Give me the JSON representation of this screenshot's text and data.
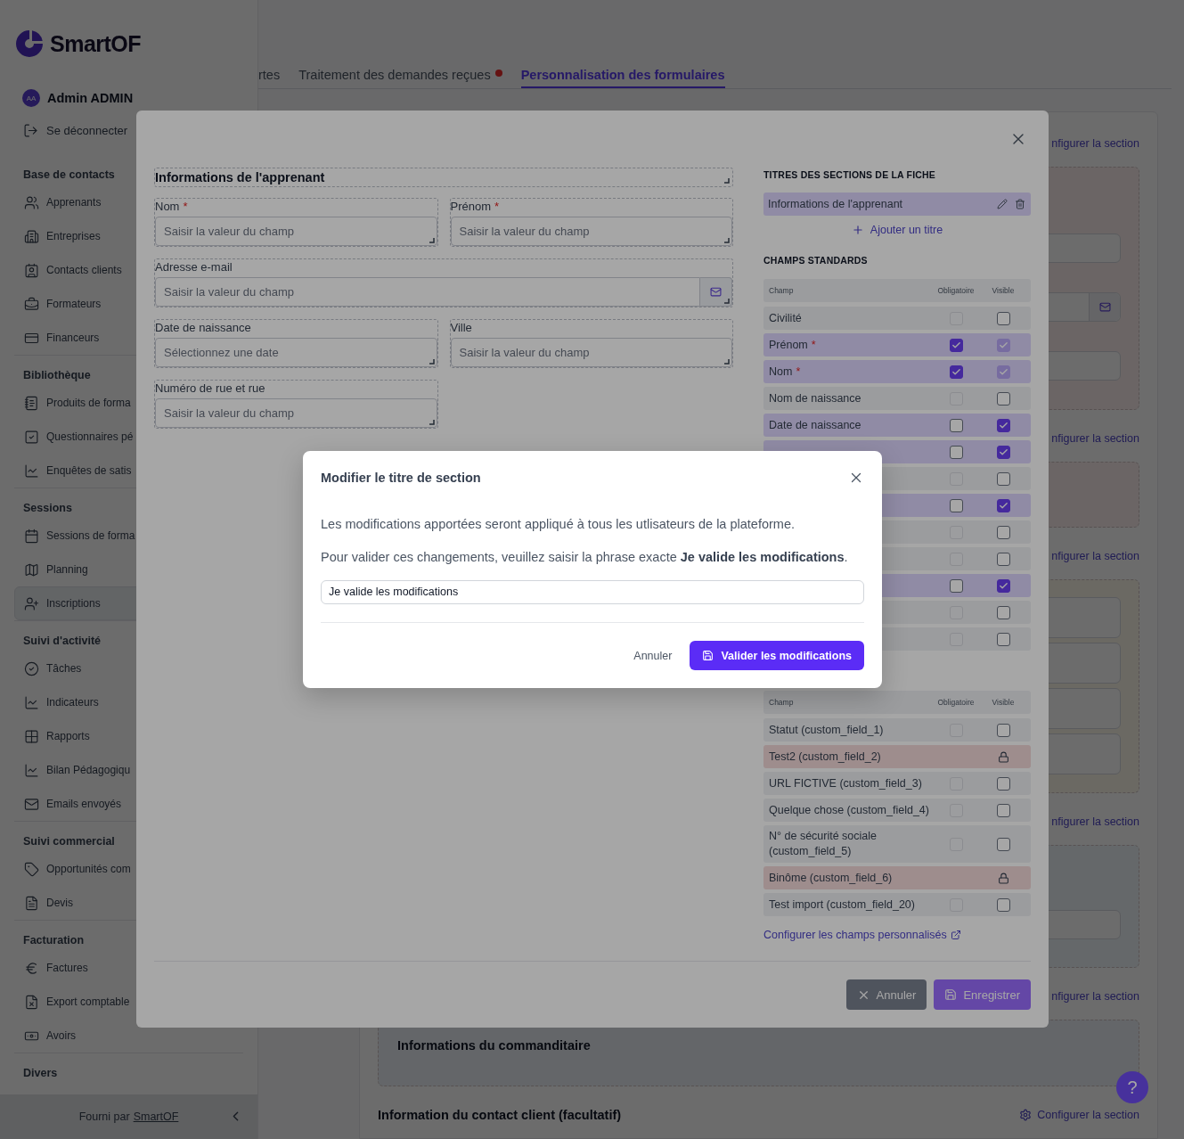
{
  "sidebar": {
    "logo": "SmartOF",
    "user": {
      "initials": "AA",
      "name": "Admin ADMIN"
    },
    "logout": "Se déconnecter",
    "sections": [
      {
        "title": "Base de contacts",
        "items": [
          {
            "label": "Apprenants",
            "selected": false
          },
          {
            "label": "Entreprises",
            "selected": false
          },
          {
            "label": "Contacts clients",
            "selected": false
          },
          {
            "label": "Formateurs",
            "selected": false
          },
          {
            "label": "Financeurs",
            "selected": false
          }
        ]
      },
      {
        "title": "Bibliothèque",
        "items": [
          {
            "label": "Produits de forma",
            "selected": false
          },
          {
            "label": "Questionnaires pé",
            "selected": false
          },
          {
            "label": "Enquêtes de satis",
            "selected": false
          }
        ]
      },
      {
        "title": "Sessions",
        "items": [
          {
            "label": "Sessions de forma",
            "selected": false
          },
          {
            "label": "Planning",
            "selected": false
          },
          {
            "label": "Inscriptions",
            "selected": true
          }
        ]
      },
      {
        "title": "Suivi d'activité",
        "items": [
          {
            "label": "Tâches",
            "selected": false
          },
          {
            "label": "Indicateurs",
            "selected": false
          },
          {
            "label": "Rapports",
            "selected": false
          },
          {
            "label": "Bilan Pédagogiqu",
            "selected": false
          },
          {
            "label": "Emails envoyés",
            "selected": false
          }
        ]
      },
      {
        "title": "Suivi commercial",
        "items": [
          {
            "label": "Opportunités com",
            "selected": false
          },
          {
            "label": "Devis",
            "selected": false
          }
        ]
      },
      {
        "title": "Facturation",
        "items": [
          {
            "label": "Factures",
            "selected": false
          },
          {
            "label": "Export comptable",
            "selected": false
          },
          {
            "label": "Avoirs",
            "selected": false
          }
        ]
      },
      {
        "title": "Divers"
      }
    ],
    "footer": {
      "text": "Fourni par",
      "link": "SmartOF"
    }
  },
  "tabs": [
    {
      "label": "rtes",
      "selected": false,
      "badge": false
    },
    {
      "label": "Traitement des demandes reçues",
      "selected": false,
      "badge": true
    },
    {
      "label": "Personnalisation des formulaires",
      "selected": true,
      "badge": false
    }
  ],
  "page": {
    "sections": [
      {
        "link": "nfigurer la section",
        "gear": false,
        "card": {
          "kind": "pink",
          "inputs": [
            {
              "kind": "text"
            },
            {
              "kind": "email"
            },
            {
              "kind": "text"
            }
          ]
        }
      },
      {
        "link": "nfigurer la section",
        "gear": false,
        "card": {
          "kind": "pink"
        }
      },
      {
        "link": "nfigurer la section",
        "gear": false,
        "card": {
          "kind": "amber",
          "inputs": [
            {
              "kind": "tall"
            },
            {
              "kind": "tall"
            },
            {
              "kind": "tall"
            },
            {
              "kind": "tall"
            }
          ]
        }
      },
      {
        "link": "nfigurer la section",
        "gear": false,
        "card": {
          "kind": "blue",
          "inputs": [
            {
              "kind": "text"
            }
          ]
        }
      },
      {
        "link": "nfigurer la section",
        "gear": false,
        "card": {
          "kind": "slate",
          "title": "Informations du commanditaire"
        }
      },
      {
        "title": "Information du contact client (facultatif)",
        "link": "Configurer la section",
        "gear": true
      }
    ],
    "help": "?"
  },
  "modal": {
    "form": {
      "title": "Informations de l'apprenant",
      "fields": [
        {
          "label": "Nom",
          "mark": "*",
          "placeholder": "Saisir la valeur du champ",
          "kind": "text"
        },
        {
          "label": "Prénom",
          "mark": "*",
          "placeholder": "Saisir la valeur du champ",
          "kind": "text"
        },
        {
          "label": "Adresse e-mail",
          "placeholder": "Saisir la valeur du champ",
          "kind": "email"
        },
        {
          "label": "Date de naissance",
          "placeholder": "Sélectionnez une date",
          "kind": "text"
        },
        {
          "label": "Ville",
          "placeholder": "Saisir la valeur du champ",
          "kind": "text"
        },
        {
          "label": "Numéro de rue et rue",
          "placeholder": "Saisir la valeur du champ",
          "kind": "text"
        }
      ]
    },
    "panel": {
      "titles_heading": "TITRES DES SECTIONS DE LA FICHE",
      "titles": [
        {
          "label": "Informations de l'apprenant"
        }
      ],
      "add_title": "Ajouter un titre",
      "standard": {
        "heading": "CHAMPS STANDARDS",
        "columns": [
          "Champ",
          "Obligatoire",
          "Visible"
        ],
        "rows": [
          {
            "kind": "checkbox",
            "label": "Civilité",
            "mandatory": {
              "checked": false,
              "disabled": true
            },
            "visible": {
              "checked": false,
              "disabled": false
            }
          },
          {
            "kind": "checkbox",
            "label": "Prénom",
            "mark": "*",
            "mandatory": {
              "checked": true,
              "disabled": false
            },
            "visible": {
              "checked": true,
              "disabled": true
            }
          },
          {
            "kind": "checkbox",
            "label": "Nom",
            "mark": "*",
            "mandatory": {
              "checked": true,
              "disabled": false
            },
            "visible": {
              "checked": true,
              "disabled": true
            }
          },
          {
            "kind": "checkbox",
            "label": "Nom de naissance",
            "mandatory": {
              "checked": false,
              "disabled": true
            },
            "visible": {
              "checked": false,
              "disabled": false
            }
          },
          {
            "kind": "checkbox",
            "label": "Date de naissance",
            "mandatory": {
              "checked": false,
              "disabled": false
            },
            "visible": {
              "checked": true,
              "disabled": false
            }
          },
          {
            "kind": "checkbox",
            "mandatory": {
              "checked": false,
              "disabled": false
            },
            "visible": {
              "checked": true,
              "disabled": false
            }
          },
          {
            "kind": "checkbox",
            "mandatory": {
              "checked": false,
              "disabled": true
            },
            "visible": {
              "checked": false,
              "disabled": false
            }
          },
          {
            "kind": "checkbox",
            "mandatory": {
              "checked": false,
              "disabled": false
            },
            "visible": {
              "checked": true,
              "disabled": false
            }
          },
          {
            "kind": "checkbox",
            "mandatory": {
              "checked": false,
              "disabled": true
            },
            "visible": {
              "checked": false,
              "disabled": false
            }
          },
          {
            "kind": "checkbox",
            "mandatory": {
              "checked": false,
              "disabled": true
            },
            "visible": {
              "checked": false,
              "disabled": false
            }
          },
          {
            "kind": "checkbox",
            "mandatory": {
              "checked": false,
              "disabled": false
            },
            "visible": {
              "checked": true,
              "disabled": false
            }
          },
          {
            "kind": "checkbox",
            "mandatory": {
              "checked": false,
              "disabled": true
            },
            "visible": {
              "checked": false,
              "disabled": false
            }
          },
          {
            "kind": "checkbox",
            "mandatory": {
              "checked": false,
              "disabled": true
            },
            "visible": {
              "checked": false,
              "disabled": false
            }
          }
        ]
      },
      "custom": {
        "columns": [
          "Champ",
          "Obligatoire",
          "Visible"
        ],
        "rows": [
          {
            "kind": "checkbox",
            "label": "Statut (custom_field_1)",
            "mandatory": {
              "checked": false,
              "disabled": true
            },
            "visible": {
              "checked": false,
              "disabled": false
            }
          },
          {
            "kind": "locked",
            "label": "Test2 (custom_field_2)"
          },
          {
            "kind": "checkbox",
            "label": "URL FICTIVE (custom_field_3)",
            "mandatory": {
              "checked": false,
              "disabled": true
            },
            "visible": {
              "checked": false,
              "disabled": false
            }
          },
          {
            "kind": "checkbox",
            "label": "Quelque chose (custom_field_4)",
            "mandatory": {
              "checked": false,
              "disabled": true
            },
            "visible": {
              "checked": false,
              "disabled": false
            }
          },
          {
            "kind": "checkbox",
            "label": "N° de sécurité sociale (custom_field_5)",
            "mandatory": {
              "checked": false,
              "disabled": true
            },
            "visible": {
              "checked": false,
              "disabled": false
            }
          },
          {
            "kind": "locked",
            "label": "Binôme (custom_field_6)"
          },
          {
            "kind": "checkbox",
            "label": "Test import (custom_field_20)",
            "mandatory": {
              "checked": false,
              "disabled": true
            },
            "visible": {
              "checked": false,
              "disabled": false
            }
          }
        ]
      },
      "custom_link": "Configurer les champs personnalisés"
    },
    "buttons": [
      {
        "label": "Annuler",
        "kind": "secondary"
      },
      {
        "label": "Enregistrer",
        "kind": "primary"
      }
    ]
  },
  "dialog": {
    "title": "Modifier le titre de section",
    "paragraphs": [
      "Les modifications apportées seront appliqué à tous les utlisateurs de la plateforme.",
      "Pour valider ces changements, veuillez saisir la phrase exacte **Je valide les modifications**."
    ],
    "input": {
      "value": "Je valide les modifications"
    },
    "buttons": [
      {
        "label": "Annuler",
        "kind": "link"
      },
      {
        "label": "Valider les modifications",
        "kind": "primary"
      }
    ]
  }
}
